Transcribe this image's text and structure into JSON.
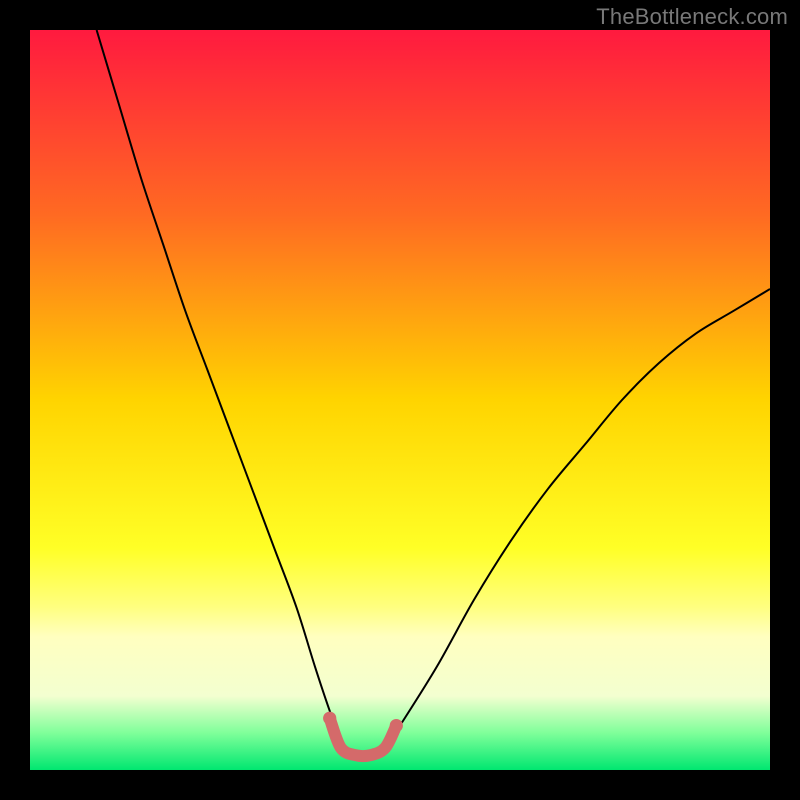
{
  "watermark": "TheBottleneck.com",
  "chart_data": {
    "type": "line",
    "title": "",
    "xlabel": "",
    "ylabel": "",
    "xlim": [
      0,
      100
    ],
    "ylim": [
      0,
      100
    ],
    "background_gradient": {
      "stops": [
        {
          "offset": 0.0,
          "color": "#ff1a3f"
        },
        {
          "offset": 0.25,
          "color": "#ff6a22"
        },
        {
          "offset": 0.5,
          "color": "#ffd400"
        },
        {
          "offset": 0.7,
          "color": "#ffff26"
        },
        {
          "offset": 0.78,
          "color": "#ffff80"
        },
        {
          "offset": 0.82,
          "color": "#ffffc0"
        },
        {
          "offset": 0.9,
          "color": "#f3ffd0"
        },
        {
          "offset": 0.95,
          "color": "#7fff9a"
        },
        {
          "offset": 1.0,
          "color": "#00e770"
        }
      ]
    },
    "series": [
      {
        "name": "bottleneck-curve",
        "stroke": "#000000",
        "stroke_width": 2,
        "x": [
          9,
          12,
          15,
          18,
          21,
          24,
          27,
          30,
          33,
          36,
          38.5,
          40.5,
          42,
          44,
          46,
          48,
          50,
          55,
          60,
          65,
          70,
          75,
          80,
          85,
          90,
          95,
          100
        ],
        "y": [
          100,
          90,
          80,
          71,
          62,
          54,
          46,
          38,
          30,
          22,
          14,
          8,
          4,
          2,
          2,
          3,
          6,
          14,
          23,
          31,
          38,
          44,
          50,
          55,
          59,
          62,
          65
        ]
      },
      {
        "name": "bottleneck-flat-marker",
        "stroke": "#d46a6a",
        "stroke_width": 12,
        "linecap": "round",
        "x": [
          40.5,
          42,
          44,
          46,
          48,
          49.5
        ],
        "y": [
          7,
          3,
          2,
          2,
          3,
          6
        ]
      }
    ]
  }
}
